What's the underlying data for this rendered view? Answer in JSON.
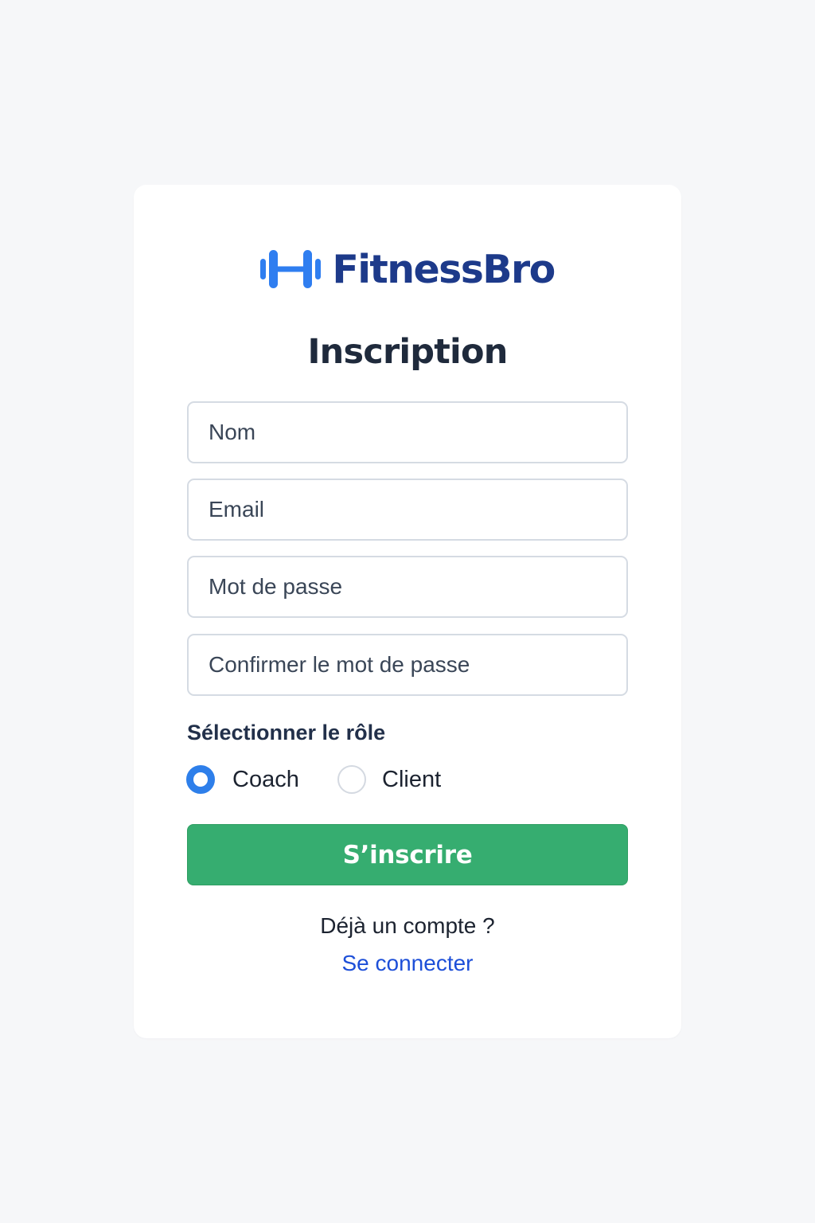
{
  "brand": {
    "name": "FitnessBro",
    "logo_icon": "dumbbell-icon",
    "color_logo": "#2f7ef0",
    "color_name": "#1d3a8a"
  },
  "form": {
    "title": "Inscription",
    "fields": {
      "name": {
        "placeholder": "Nom",
        "value": ""
      },
      "email": {
        "placeholder": "Email",
        "value": ""
      },
      "password": {
        "placeholder": "Mot de passe",
        "value": ""
      },
      "confirm_password": {
        "placeholder": "Confirmer le mot de passe",
        "value": ""
      }
    },
    "role": {
      "label": "Sélectionner le rôle",
      "options": [
        {
          "label": "Coach",
          "selected": true
        },
        {
          "label": "Client",
          "selected": false
        }
      ]
    },
    "submit_label": "S’inscrire",
    "submit_color": "#36ad70"
  },
  "footer": {
    "account_text": "Déjà un compte ?",
    "login_link": "Se connecter",
    "link_color": "#1d4fd8"
  }
}
